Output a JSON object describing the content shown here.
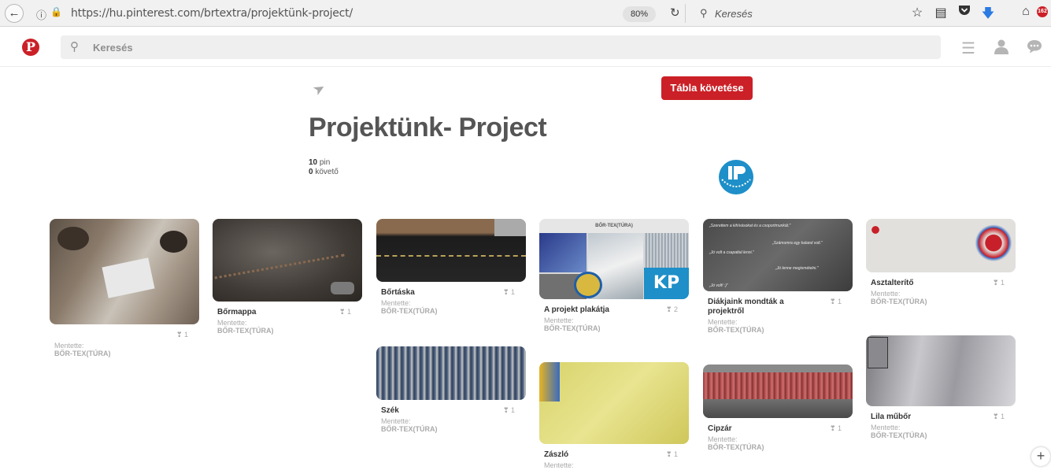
{
  "browser": {
    "url": "https://hu.pinterest.com/brtextra/projektünk-project/",
    "zoom": "80%",
    "search_placeholder": "Keresés",
    "icons": [
      "back-icon",
      "info-icon",
      "lock-icon",
      "reload-icon",
      "search-icon",
      "star-icon",
      "reading-list-icon",
      "pocket-icon",
      "download-icon",
      "home-icon"
    ]
  },
  "pinterest": {
    "logo": "P",
    "search_placeholder": "Keresés",
    "notification_count": "162",
    "brand_color": "#cb2027"
  },
  "board": {
    "title": "Projektünk- Project",
    "follow_label": "Tábla követése",
    "pins_count": "10",
    "pins_label": "pin",
    "followers_count": "0",
    "followers_label": "követő"
  },
  "saved_label": "Mentette:",
  "pins": [
    {
      "title": "",
      "count": "1",
      "saved_by": "BŐR-TEX(TÚRA)"
    },
    {
      "title": "Bőrmappa",
      "count": "1",
      "saved_by": "BŐR-TEX(TÚRA)"
    },
    {
      "title": "Bőrtáska",
      "count": "1",
      "saved_by": "BŐR-TEX(TÚRA)"
    },
    {
      "title": "Szék",
      "count": "1",
      "saved_by": "BŐR-TEX(TÚRA)"
    },
    {
      "title": "A projekt plakátja",
      "count": "2",
      "saved_by": "BŐR-TEX(TÚRA)",
      "banner": "BŐR-TEX(TÚRA)"
    },
    {
      "title": "Zászló",
      "count": "1",
      "saved_by": ""
    },
    {
      "title": "Diákjaink mondták a projektről",
      "count": "1",
      "saved_by": "BŐR-TEX(TÚRA)",
      "quotes": [
        "„Szerettem a kihívásokat és a csoportmunkát.\"",
        "„Számomra egy kaland volt.\"",
        "„Jó volt a csapattal lenni.\"",
        "„Jó lenne megismételni.\"",
        "„Jó volt! :)\""
      ]
    },
    {
      "title": "Cipzár",
      "count": "1",
      "saved_by": "BŐR-TEX(TÚRA)"
    },
    {
      "title": "Asztalterítő",
      "count": "1",
      "saved_by": "BŐR-TEX(TÚRA)"
    },
    {
      "title": "Lila műbőr",
      "count": "1",
      "saved_by": "BŐR-TEX(TÚRA)"
    }
  ]
}
